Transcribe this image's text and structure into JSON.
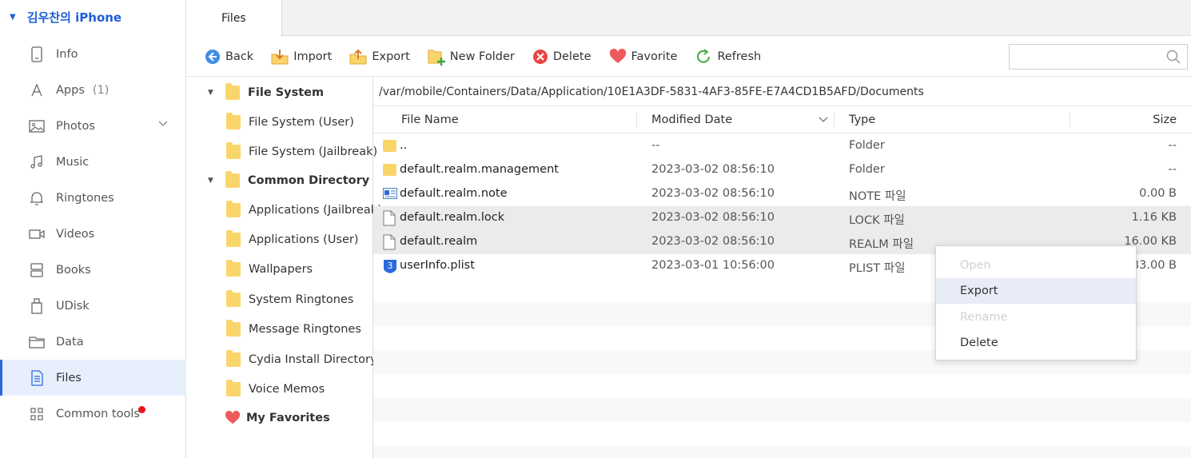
{
  "device": {
    "name": "김우찬의 iPhone"
  },
  "sidebar": {
    "items": [
      {
        "label": "Info"
      },
      {
        "label": "Apps",
        "count": "(1)"
      },
      {
        "label": "Photos"
      },
      {
        "label": "Music"
      },
      {
        "label": "Ringtones"
      },
      {
        "label": "Videos"
      },
      {
        "label": "Books"
      },
      {
        "label": "UDisk"
      },
      {
        "label": "Data"
      },
      {
        "label": "Files"
      },
      {
        "label": "Common tools"
      }
    ]
  },
  "tabs": [
    {
      "label": "Files"
    }
  ],
  "toolbar": {
    "back": "Back",
    "import": "Import",
    "export": "Export",
    "new_folder": "New Folder",
    "delete": "Delete",
    "favorite": "Favorite",
    "refresh": "Refresh",
    "search_placeholder": ""
  },
  "tree": {
    "file_system": "File System",
    "fs_user": "File System (User)",
    "fs_jailbreak": "File System (Jailbreak)",
    "common_directory": "Common Directory",
    "apps_jailbreak": "Applications (Jailbreak)",
    "apps_user": "Applications (User)",
    "wallpapers": "Wallpapers",
    "system_ringtones": "System Ringtones",
    "message_ringtones": "Message Ringtones",
    "cydia": "Cydia Install Directory",
    "voice_memos": "Voice Memos",
    "favorites": "My Favorites"
  },
  "path": "/var/mobile/Containers/Data/Application/10E1A3DF-5831-4AF3-85FE-E7A4CD1B5AFD/Documents",
  "columns": {
    "name": "File Name",
    "date": "Modified Date",
    "type": "Type",
    "size": "Size"
  },
  "files": [
    {
      "name": "..",
      "date": "--",
      "type": "Folder",
      "size": "--",
      "icon": "folder-icon"
    },
    {
      "name": "default.realm.management",
      "date": "2023-03-02 08:56:10",
      "type": "Folder",
      "size": "--",
      "icon": "folder-icon"
    },
    {
      "name": "default.realm.note",
      "date": "2023-03-02 08:56:10",
      "type": "NOTE 파일",
      "size": "0.00 B",
      "icon": "note-file-icon"
    },
    {
      "name": "default.realm.lock",
      "date": "2023-03-02 08:56:10",
      "type": "LOCK 파일",
      "size": "1.16 KB",
      "icon": "file-icon"
    },
    {
      "name": "default.realm",
      "date": "2023-03-02 08:56:10",
      "type": "REALM 파일",
      "size": "16.00 KB",
      "icon": "file-icon"
    },
    {
      "name": "userInfo.plist",
      "date": "2023-03-01 10:56:00",
      "type": "PLIST 파일",
      "size": "283.00 B",
      "icon": "plist-file-icon"
    }
  ],
  "context_menu": {
    "open": "Open",
    "export": "Export",
    "rename": "Rename",
    "delete": "Delete"
  },
  "colors": {
    "accent": "#2a6ae0",
    "folder": "#fad56b",
    "notification": "#e8131d"
  }
}
